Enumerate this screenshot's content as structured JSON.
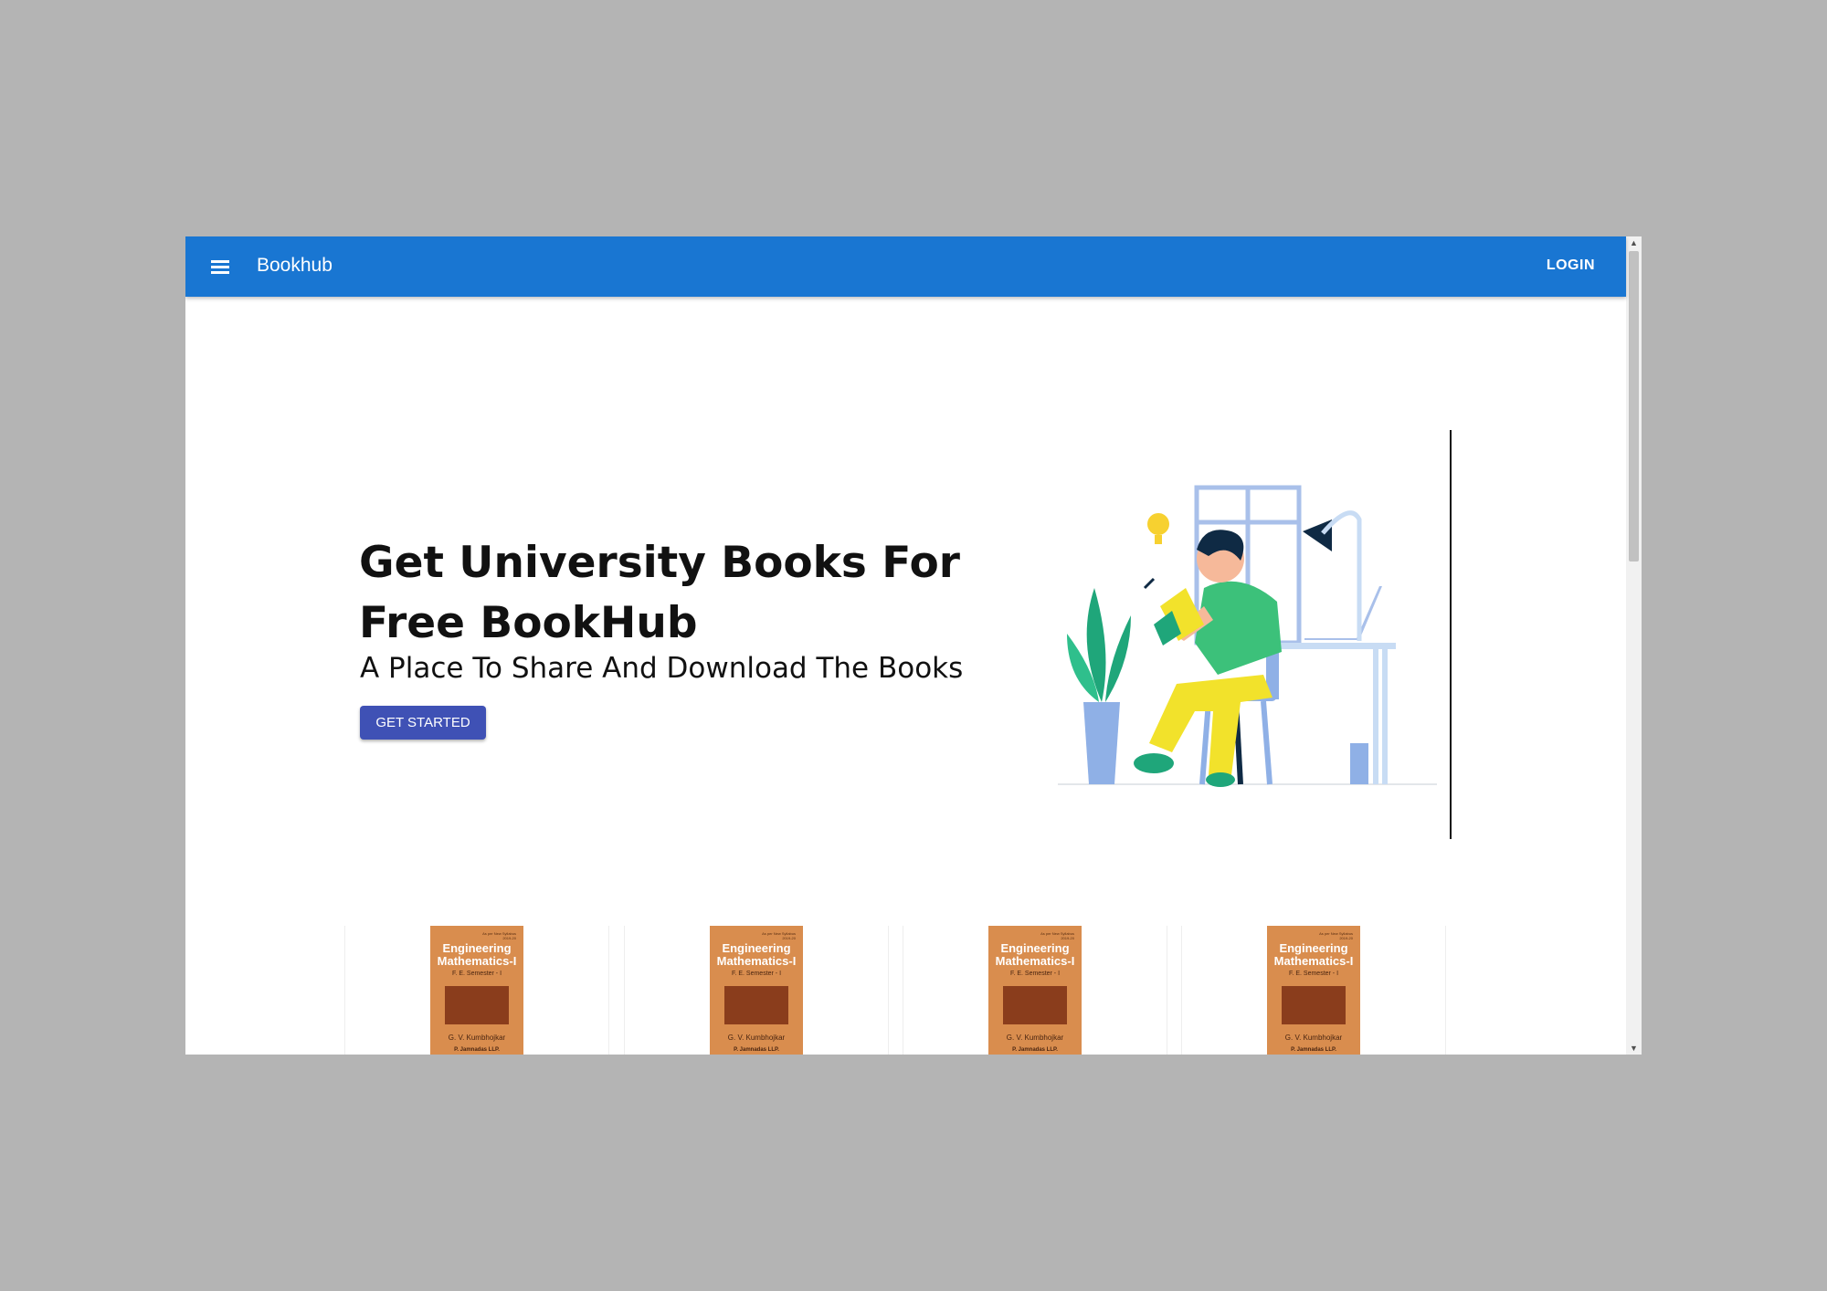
{
  "appbar": {
    "menu_icon": "hamburger-menu-icon",
    "title": "Bookhub",
    "login_label": "LOGIN",
    "color": "#1976d2"
  },
  "hero": {
    "title": "Get University Books For Free BookHub",
    "subtitle": "A Place To Share And Download The Books",
    "cta_label": "GET STARTED",
    "cta_color": "#3f51b5",
    "illustration": "person-reading-at-desk-illustration"
  },
  "books": [
    {
      "tag": "As per New Syllabus 2019-20",
      "title": "Engineering Mathematics-I",
      "semester": "F. E. Semester - I",
      "author": "G. V. Kumbhojkar",
      "publisher": "P. Jamnadas LLP."
    },
    {
      "tag": "As per New Syllabus 2019-20",
      "title": "Engineering Mathematics-I",
      "semester": "F. E. Semester - I",
      "author": "G. V. Kumbhojkar",
      "publisher": "P. Jamnadas LLP."
    },
    {
      "tag": "As per New Syllabus 2019-20",
      "title": "Engineering Mathematics-I",
      "semester": "F. E. Semester - I",
      "author": "G. V. Kumbhojkar",
      "publisher": "P. Jamnadas LLP."
    },
    {
      "tag": "As per New Syllabus 2019-20",
      "title": "Engineering Mathematics-I",
      "semester": "F. E. Semester - I",
      "author": "G. V. Kumbhojkar",
      "publisher": "P. Jamnadas LLP."
    }
  ]
}
